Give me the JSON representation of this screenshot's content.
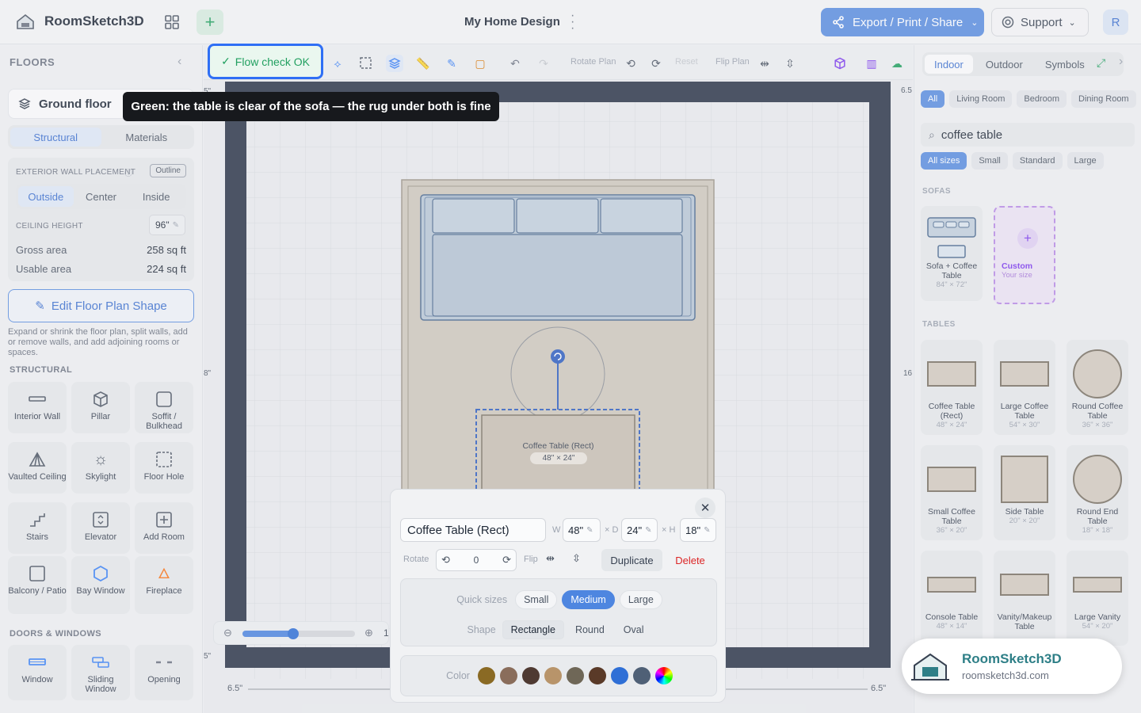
{
  "header": {
    "app_name": "RoomSketch3D",
    "project_title": "My Home Design",
    "export_label": "Export / Print / Share",
    "support_label": "Support",
    "avatar_initial": "R",
    "brand_color": "#5b8ee0"
  },
  "floors_panel": {
    "title": "FLOORS",
    "current_floor": "Ground floor",
    "tabs": [
      "Structural",
      "Materials"
    ],
    "active_tab": "Structural",
    "wall_placement_label": "EXTERIOR WALL PLACEMENT",
    "outline_badge": "Outline",
    "wall_options": [
      "Outside",
      "Center",
      "Inside"
    ],
    "active_wall_option": "Outside",
    "ceiling_label": "CEILING HEIGHT",
    "ceiling_value": "96\"",
    "gross_label": "Gross area",
    "gross_value": "258 sq ft",
    "usable_label": "Usable area",
    "usable_value": "224 sq ft",
    "edit_button": "Edit Floor Plan Shape",
    "help_text": "Expand or shrink the floor plan, split walls, add or remove walls, and add adjoining rooms or spaces.",
    "structural_title": "STRUCTURAL",
    "structural_items": [
      "Interior Wall",
      "Pillar",
      "Soffit / Bulkhead",
      "Vaulted Ceiling",
      "Skylight",
      "Floor Hole",
      "Stairs",
      "Elevator",
      "Add Room",
      "Balcony / Patio",
      "Bay Window",
      "Fireplace"
    ],
    "doors_title": "DOORS & WINDOWS",
    "door_items": [
      "Window",
      "Sliding Window",
      "Opening"
    ]
  },
  "toolbar": {
    "flow_check": "Flow check OK",
    "rotate_plan": "Rotate Plan",
    "reset": "Reset",
    "flip_plan": "Flip Plan"
  },
  "tooltip": "Green: the table is clear of the sofa — the rug under both is fine",
  "canvas": {
    "item_label": "Coffee Table (Rect)",
    "item_dims": "48\" × 24\"",
    "dim_left": "6.5\"",
    "dim_right": "6.5\"",
    "side_left": "8\"",
    "side_right": "16",
    "corner_tl": "5\"",
    "corner_tr": "6.5",
    "corner_bl": "5\"",
    "zoom_value": 0.45,
    "zoom_label": "1"
  },
  "properties": {
    "name": "Coffee Table (Rect)",
    "w_label": "W",
    "w_value": "48\"",
    "d_label": "× D",
    "d_value": "24\"",
    "h_label": "× H",
    "h_value": "18\"",
    "rotate_label": "Rotate",
    "rotate_value": "0",
    "flip_label": "Flip",
    "duplicate": "Duplicate",
    "delete": "Delete",
    "quick_sizes_label": "Quick sizes",
    "sizes": [
      "Small",
      "Medium",
      "Large"
    ],
    "active_size": "Medium",
    "shape_label": "Shape",
    "shapes": [
      "Rectangle",
      "Round",
      "Oval"
    ],
    "active_shape": "Rectangle",
    "color_label": "Color",
    "colors": [
      "#8a6a24",
      "#8a6d5b",
      "#4f3a32",
      "#b8946a",
      "#6f6757",
      "#5a3a28",
      "#2f6fd6",
      "#4f6076"
    ]
  },
  "library": {
    "tabs": [
      "Indoor",
      "Outdoor",
      "Symbols"
    ],
    "active_tab": "Indoor",
    "room_chips": [
      "All",
      "Living Room",
      "Bedroom",
      "Dining Room"
    ],
    "active_room": "All",
    "search_value": "coffee table",
    "size_chips": [
      "All sizes",
      "Small",
      "Standard",
      "Large"
    ],
    "active_size": "All sizes",
    "sofas_title": "SOFAS",
    "sofa_items": [
      {
        "name": "Sofa + Coffee Table",
        "dims": "84\" × 72\""
      },
      {
        "name": "Custom",
        "dims": "Your size"
      }
    ],
    "tables_title": "TABLES",
    "table_items": [
      {
        "name": "Coffee Table (Rect)",
        "dims": "48\" × 24\""
      },
      {
        "name": "Large Coffee Table",
        "dims": "54\" × 30\""
      },
      {
        "name": "Round Coffee Table",
        "dims": "36\" × 36\""
      },
      {
        "name": "Small Coffee Table",
        "dims": "36\" × 20\""
      },
      {
        "name": "Side Table",
        "dims": "20\" × 20\""
      },
      {
        "name": "Round End Table",
        "dims": "18\" × 18\""
      },
      {
        "name": "Console Table",
        "dims": "48\" × 14\""
      },
      {
        "name": "Vanity/Makeup Table",
        "dims": ""
      },
      {
        "name": "Large Vanity",
        "dims": "54\" × 20\""
      }
    ]
  },
  "promo": {
    "name": "RoomSketch3D",
    "url": "roomsketch3d.com"
  }
}
